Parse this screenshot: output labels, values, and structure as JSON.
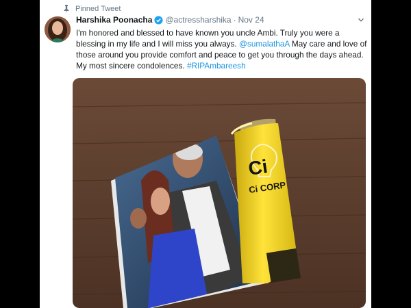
{
  "pinned_label": "Pinned Tweet",
  "author": {
    "name": "Harshika Poonacha",
    "handle": "@actressharshika",
    "dot": "·",
    "date": "Nov 24"
  },
  "tweet": {
    "p1": "I'm honored and blessed to have known you uncle Ambi. Truly you were a blessing in my life and I will miss you always. ",
    "mention": "@sumalathaA",
    "p2": "  May care and love of those around you provide comfort and peace to get you through the days ahead. My most sincere condolences. ",
    "hashtag": "#RIPAmbareesh"
  },
  "media": {
    "brand_mark": "Ci",
    "brand_name": "Ci CORP"
  },
  "colors": {
    "link": "#1b95e0",
    "muted": "#657786",
    "text": "#14171a",
    "verified": "#1da1f2",
    "wood": "#5a3c2c"
  }
}
